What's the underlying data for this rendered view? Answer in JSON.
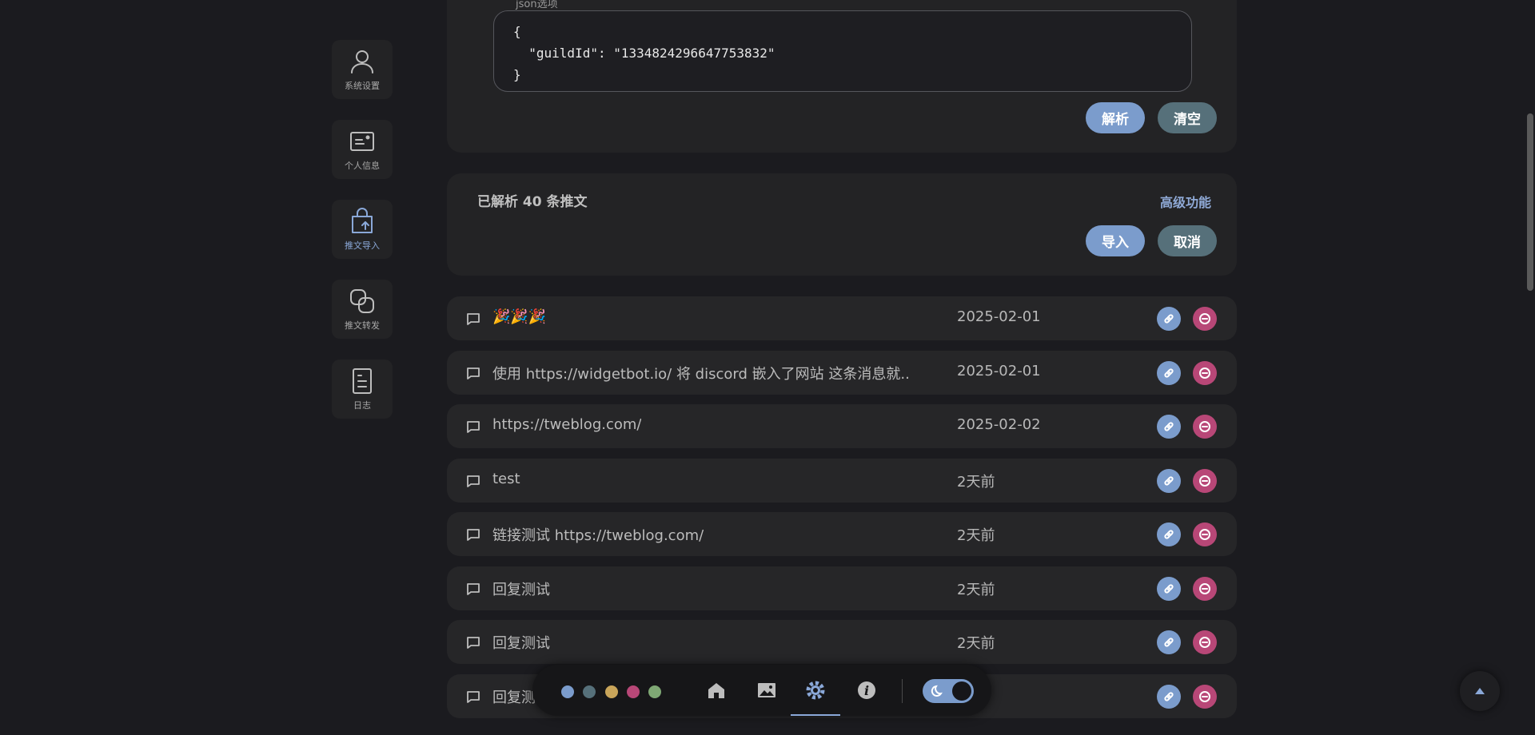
{
  "sidebar": {
    "items": [
      {
        "label": "系统设置",
        "icon": "user-icon"
      },
      {
        "label": "个人信息",
        "icon": "id-card-icon"
      },
      {
        "label": "推文导入",
        "icon": "shopping-bag-upload-icon"
      },
      {
        "label": "推文转发",
        "icon": "link-chain-icon"
      },
      {
        "label": "日志",
        "icon": "document-icon"
      }
    ],
    "active_index": 2
  },
  "json_options": {
    "legend": "json选项",
    "content": "{\n  \"guildId\": \"1334824296647753832\"\n}",
    "parse_label": "解析",
    "clear_label": "清空"
  },
  "status": {
    "text": "已解析 40 条推文",
    "advanced_label": "高级功能",
    "import_label": "导入",
    "cancel_label": "取消"
  },
  "tweets": [
    {
      "text": "🎉🎉🎉",
      "date": "2025-02-01"
    },
    {
      "text": "使用 https://widgetbot.io/ 将 discord 嵌入了网站 这条消息就...",
      "date": "2025-02-01"
    },
    {
      "text": "https://tweblog.com/",
      "date": "2025-02-02"
    },
    {
      "text": "test",
      "date": "2天前"
    },
    {
      "text": "链接测试 https://tweblog.com/",
      "date": "2天前"
    },
    {
      "text": "回复测试",
      "date": "2天前"
    },
    {
      "text": "回复测试",
      "date": "2天前"
    },
    {
      "text": "回复测",
      "date": ""
    }
  ],
  "toolbar": {
    "theme_colors": [
      "#7b9ccc",
      "#56707a",
      "#c9a55a",
      "#b84777",
      "#7fa874"
    ],
    "icons": [
      "home-icon",
      "image-icon",
      "settings-icon",
      "info-icon"
    ],
    "active_icon": "settings-icon",
    "dark_mode": true
  }
}
